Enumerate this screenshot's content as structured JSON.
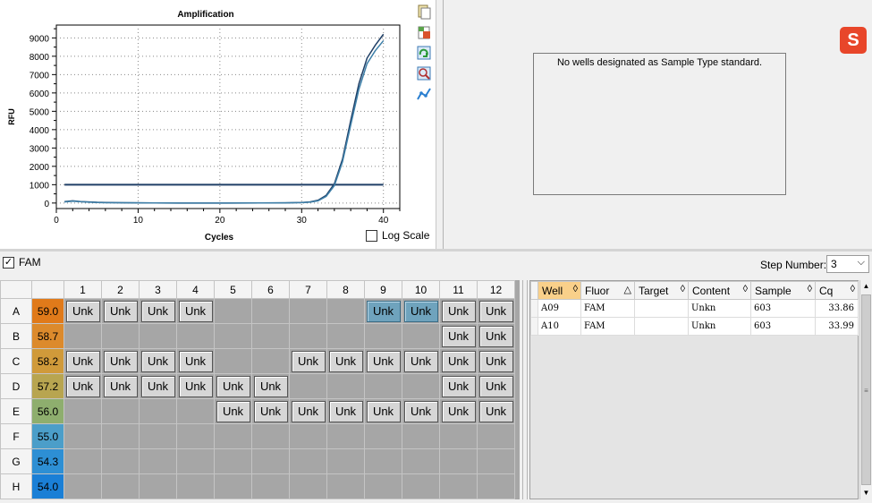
{
  "chart_data": {
    "type": "line",
    "title": "Amplification",
    "xlabel": "Cycles",
    "ylabel": "RFU",
    "xlim": [
      0,
      42
    ],
    "ylim": [
      -300,
      9700
    ],
    "xticks": [
      0,
      10,
      20,
      30,
      40
    ],
    "yticks": [
      0,
      1000,
      2000,
      3000,
      4000,
      5000,
      6000,
      7000,
      8000,
      9000
    ],
    "grid": true,
    "threshold": 1000,
    "series": [
      {
        "color": "#1f3f66",
        "x": [
          1,
          2,
          3,
          4,
          5,
          6,
          8,
          10,
          12,
          15,
          20,
          25,
          28,
          30,
          31,
          32,
          33,
          34,
          35,
          36,
          37,
          38,
          39,
          40
        ],
        "y": [
          80,
          120,
          80,
          60,
          40,
          30,
          20,
          10,
          5,
          0,
          0,
          5,
          10,
          30,
          60,
          150,
          420,
          1050,
          2400,
          4500,
          6500,
          7900,
          8600,
          9200
        ]
      },
      {
        "color": "#3d7fa8",
        "x": [
          1,
          2,
          3,
          4,
          5,
          6,
          8,
          10,
          12,
          15,
          20,
          25,
          28,
          30,
          31,
          32,
          33,
          34,
          35,
          36,
          37,
          38,
          39,
          40
        ],
        "y": [
          60,
          100,
          70,
          50,
          30,
          20,
          15,
          8,
          3,
          0,
          0,
          4,
          8,
          25,
          50,
          120,
          360,
          950,
          2250,
          4250,
          6200,
          7600,
          8300,
          8850
        ]
      }
    ]
  },
  "log_scale": {
    "label": "Log Scale",
    "checked": false
  },
  "right_panel": {
    "message": "No wells designated as Sample Type standard.",
    "logo_letter": "S"
  },
  "fluor_filter": {
    "label": "FAM",
    "checked": true
  },
  "step": {
    "label": "Step Number:",
    "value": "3"
  },
  "plate": {
    "columns": [
      "1",
      "2",
      "3",
      "4",
      "5",
      "6",
      "7",
      "8",
      "9",
      "10",
      "11",
      "12"
    ],
    "rows": [
      {
        "label": "A",
        "temp": "59.0",
        "color": "#e07a1a",
        "wells": [
          "Unk",
          "Unk",
          "Unk",
          "Unk",
          "",
          "",
          "",
          "",
          "Unk*",
          "Unk*",
          "Unk",
          "Unk"
        ]
      },
      {
        "label": "B",
        "temp": "58.7",
        "color": "#dc8a2c",
        "wells": [
          "",
          "",
          "",
          "",
          "",
          "",
          "",
          "",
          "",
          "",
          "Unk",
          "Unk"
        ]
      },
      {
        "label": "C",
        "temp": "58.2",
        "color": "#d09a3a",
        "wells": [
          "Unk",
          "Unk",
          "Unk",
          "Unk",
          "",
          "",
          "Unk",
          "Unk",
          "Unk",
          "Unk",
          "Unk",
          "Unk"
        ]
      },
      {
        "label": "D",
        "temp": "57.2",
        "color": "#b8a550",
        "wells": [
          "Unk",
          "Unk",
          "Unk",
          "Unk",
          "Unk",
          "Unk",
          "",
          "",
          "",
          "",
          "Unk",
          "Unk"
        ]
      },
      {
        "label": "E",
        "temp": "56.0",
        "color": "#8eae6e",
        "wells": [
          "",
          "",
          "",
          "",
          "Unk",
          "Unk",
          "Unk",
          "Unk",
          "Unk",
          "Unk",
          "Unk",
          "Unk"
        ]
      },
      {
        "label": "F",
        "temp": "55.0",
        "color": "#4b9ec9",
        "wells": [
          "",
          "",
          "",
          "",
          "",
          "",
          "",
          "",
          "",
          "",
          "",
          ""
        ]
      },
      {
        "label": "G",
        "temp": "54.3",
        "color": "#2d8fd4",
        "wells": [
          "",
          "",
          "",
          "",
          "",
          "",
          "",
          "",
          "",
          "",
          "",
          ""
        ]
      },
      {
        "label": "H",
        "temp": "54.0",
        "color": "#1a7fd6",
        "wells": [
          "",
          "",
          "",
          "",
          "",
          "",
          "",
          "",
          "",
          "",
          "",
          ""
        ]
      }
    ]
  },
  "results": {
    "headers": [
      {
        "label": "Well",
        "sort_icon": "◊",
        "sorted": true
      },
      {
        "label": "Fluor",
        "sort_icon": "△"
      },
      {
        "label": "Target",
        "sort_icon": "◊"
      },
      {
        "label": "Content",
        "sort_icon": "◊"
      },
      {
        "label": "Sample",
        "sort_icon": "◊"
      },
      {
        "label": "Cq",
        "sort_icon": "◊"
      }
    ],
    "rows": [
      [
        "A09",
        "FAM",
        "",
        "Unkn",
        "603",
        "33.86"
      ],
      [
        "A10",
        "FAM",
        "",
        "Unkn",
        "603",
        "33.99"
      ]
    ]
  },
  "toolbar_icons": [
    "copy-icon",
    "export-icon",
    "refresh-icon",
    "zoom-chart-icon",
    "line-style-icon"
  ]
}
